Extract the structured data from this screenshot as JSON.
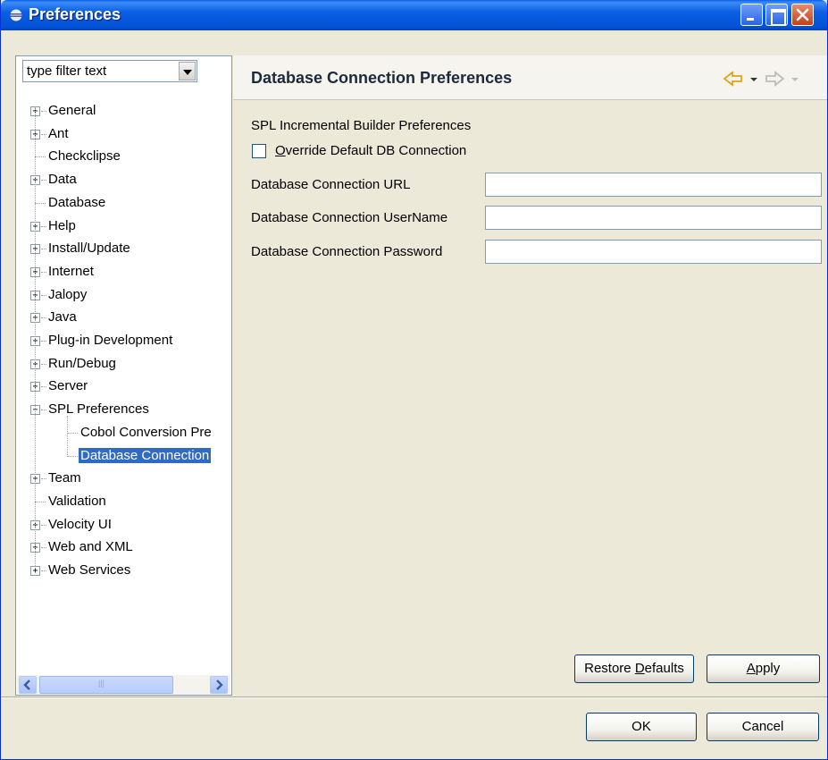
{
  "window": {
    "title": "Preferences"
  },
  "filter": {
    "text": "type filter text"
  },
  "tree": [
    {
      "label": "General",
      "expandable": true,
      "expanded": false,
      "level": 0
    },
    {
      "label": "Ant",
      "expandable": true,
      "expanded": false,
      "level": 0
    },
    {
      "label": "Checkclipse",
      "expandable": false,
      "level": 0
    },
    {
      "label": "Data",
      "expandable": true,
      "expanded": false,
      "level": 0
    },
    {
      "label": "Database",
      "expandable": false,
      "level": 0
    },
    {
      "label": "Help",
      "expandable": true,
      "expanded": false,
      "level": 0
    },
    {
      "label": "Install/Update",
      "expandable": true,
      "expanded": false,
      "level": 0
    },
    {
      "label": "Internet",
      "expandable": true,
      "expanded": false,
      "level": 0
    },
    {
      "label": "Jalopy",
      "expandable": true,
      "expanded": false,
      "level": 0
    },
    {
      "label": "Java",
      "expandable": true,
      "expanded": false,
      "level": 0
    },
    {
      "label": "Plug-in Development",
      "expandable": true,
      "expanded": false,
      "level": 0
    },
    {
      "label": "Run/Debug",
      "expandable": true,
      "expanded": false,
      "level": 0
    },
    {
      "label": "Server",
      "expandable": true,
      "expanded": false,
      "level": 0
    },
    {
      "label": "SPL Preferences",
      "expandable": true,
      "expanded": true,
      "level": 0
    },
    {
      "label": "Cobol Conversion Pre",
      "expandable": false,
      "level": 1
    },
    {
      "label": "Database Connection",
      "expandable": false,
      "level": 1,
      "selected": true
    },
    {
      "label": "Team",
      "expandable": true,
      "expanded": false,
      "level": 0
    },
    {
      "label": "Validation",
      "expandable": false,
      "level": 0
    },
    {
      "label": "Velocity UI",
      "expandable": true,
      "expanded": false,
      "level": 0
    },
    {
      "label": "Web and XML",
      "expandable": true,
      "expanded": false,
      "level": 0
    },
    {
      "label": "Web Services",
      "expandable": true,
      "expanded": false,
      "level": 0
    }
  ],
  "page": {
    "title": "Database Connection Preferences",
    "section_label": "SPL Incremental Builder Preferences",
    "override_checkbox": {
      "label_prefix": "",
      "label_mnemonic": "O",
      "label_rest": "verride Default DB Connection",
      "checked": false
    },
    "fields": [
      {
        "label": "Database Connection URL",
        "value": ""
      },
      {
        "label": "Database Connection UserName",
        "value": ""
      },
      {
        "label": "Database Connection Password",
        "value": ""
      }
    ],
    "restore_button": {
      "prefix": "Restore ",
      "mnemonic": "D",
      "rest": "efaults"
    },
    "apply_button": {
      "prefix": "",
      "mnemonic": "A",
      "rest": "pply"
    }
  },
  "dialog": {
    "ok_label": "OK",
    "cancel_label": "Cancel"
  },
  "colors": {
    "title_bar": "#0b5ee3",
    "selection": "#316ac5",
    "nav_back_icon": "#e8b93a",
    "nav_forward_icon": "#c8c8c8"
  },
  "icons": {
    "back": "back-arrow-icon",
    "forward": "forward-arrow-icon",
    "dropdown": "chevron-down-icon"
  }
}
